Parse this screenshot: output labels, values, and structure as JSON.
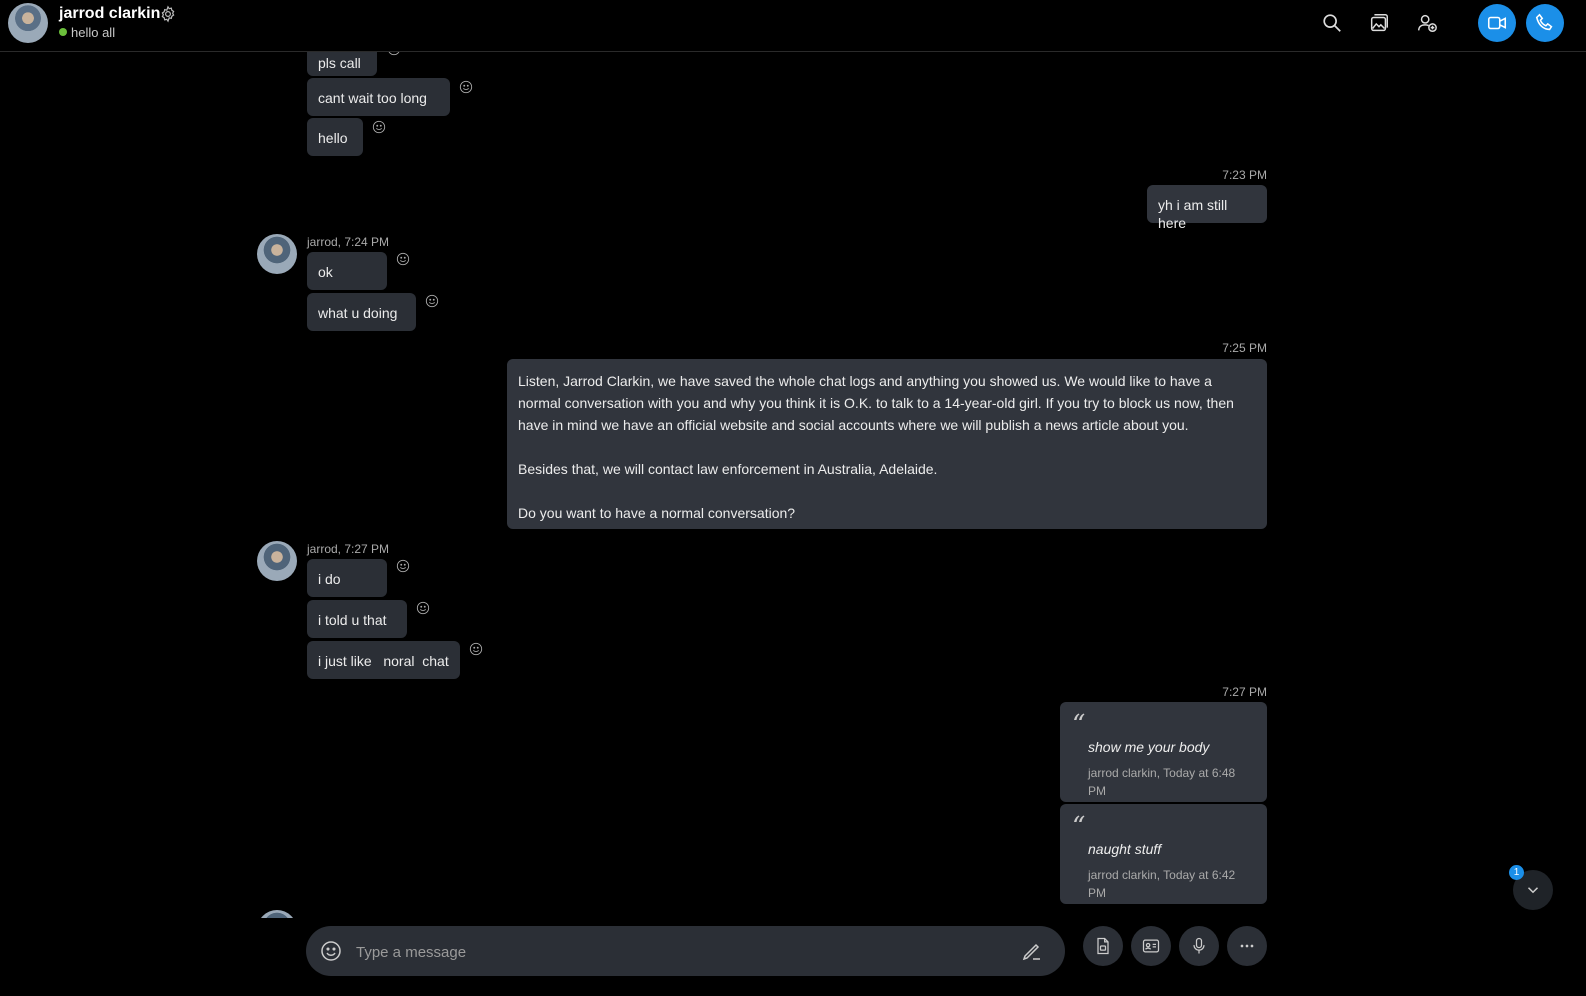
{
  "header": {
    "name": "jarrod clarkin",
    "status": "hello all"
  },
  "messages": {
    "m1": "pls call",
    "m2": "cant wait too long",
    "m3": "hello",
    "t1": "7:23 PM",
    "m4": "yh i am still here",
    "s1": "jarrod, 7:24 PM",
    "m5": "ok",
    "m6": "what u  doing",
    "t2": "7:25 PM",
    "long_p1": "Listen, Jarrod Clarkin, we have saved the whole chat logs and anything you showed us. We would like to have a normal conversation with you and why you think it is O.K. to talk to a 14-year-old girl. If you try to block us now, then have in mind we have an official website and social accounts where we will publish a news article about you.",
    "long_p2": "Besides that, we will contact law enforcement in Australia, Adelaide.",
    "long_p3": "Do you want to have a normal conversation?",
    "s2": "jarrod, 7:27 PM",
    "m7": "i do",
    "m8": "i told u that",
    "m9": "i just like   noral  chat",
    "t3": "7:27 PM",
    "q1_text": "show me  your body",
    "q1_meta": "jarrod clarkin, Today at 6:48 PM",
    "q2_text": "naught stuff",
    "q2_meta": "jarrod clarkin, Today at 6:42 PM",
    "quote_mark": "“"
  },
  "scroll": {
    "badge": "1"
  },
  "composer": {
    "placeholder": "Type a message"
  },
  "colors": {
    "accent": "#1b8fe8",
    "online": "#6bbf3b",
    "bubble": "#2b2f36"
  }
}
